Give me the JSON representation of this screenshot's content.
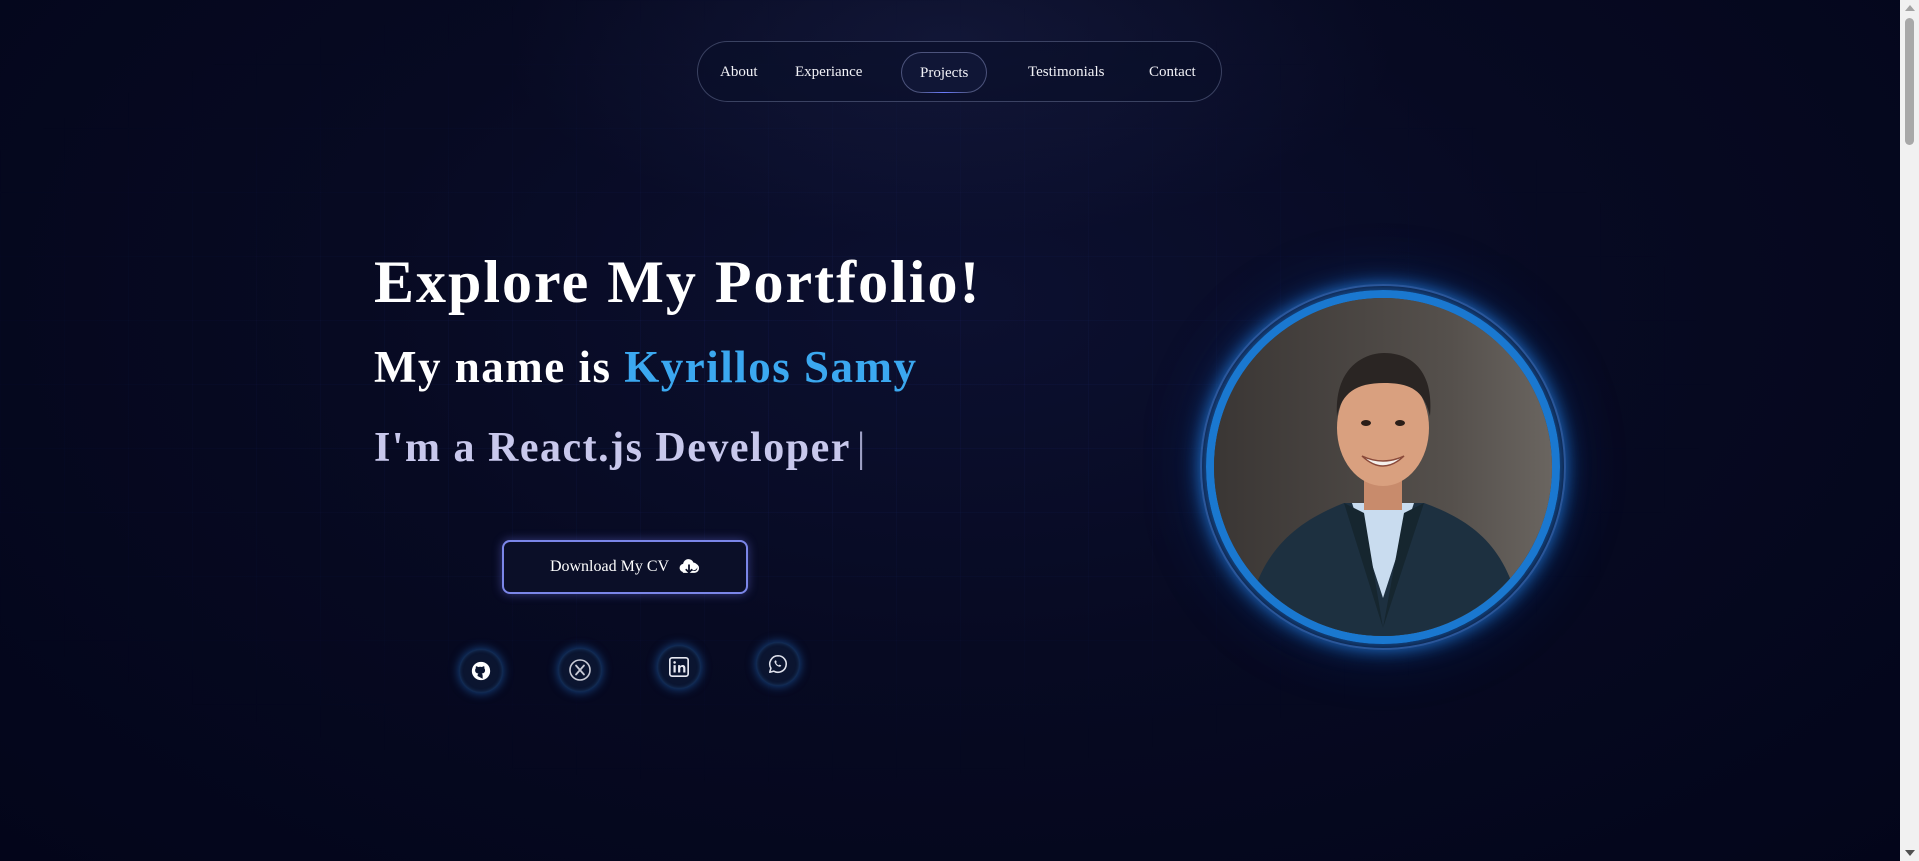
{
  "nav": {
    "items": [
      {
        "label": "About"
      },
      {
        "label": "Experiance"
      },
      {
        "label": "Projects"
      },
      {
        "label": "Testimonials"
      },
      {
        "label": "Contact"
      }
    ],
    "active": "Projects"
  },
  "hero": {
    "title": "Explore My Portfolio!",
    "name_prefix": "My name is",
    "name": "Kyrillos Samy",
    "role": "I'm a React.js Developer",
    "cursor": "|",
    "cv_button": "Download My CV",
    "cv_icon": "cloud-download-icon"
  },
  "social": [
    {
      "icon": "github-icon"
    },
    {
      "icon": "x-twitter-icon"
    },
    {
      "icon": "linkedin-icon"
    },
    {
      "icon": "whatsapp-icon"
    }
  ],
  "portrait": {
    "icon": "profile-photo"
  },
  "colors": {
    "accent": "#3ba8f0",
    "background": "#050820",
    "glow": "#1a78d0",
    "button_border": "#7b86e8"
  }
}
